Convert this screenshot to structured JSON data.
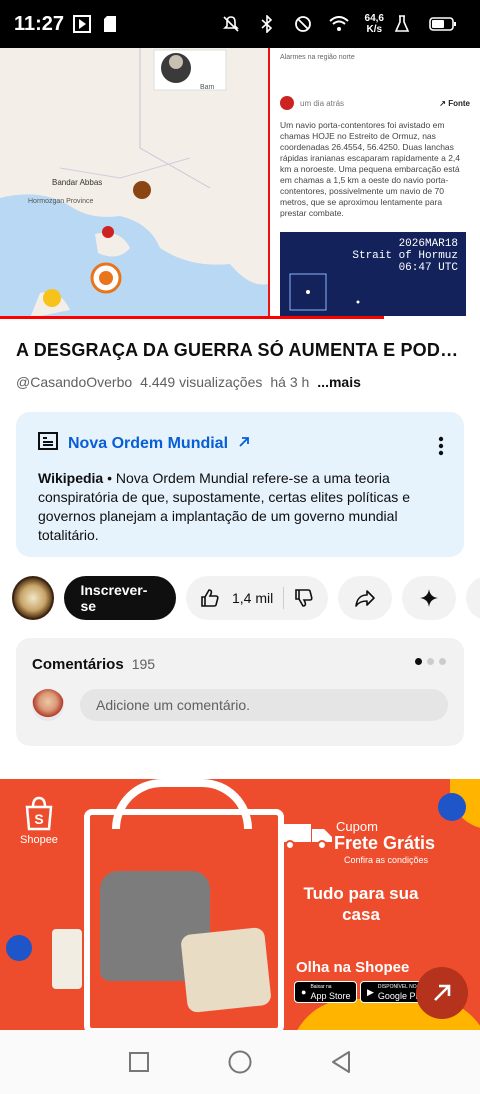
{
  "status_bar": {
    "time": "11:27",
    "speed_value": "64,6",
    "speed_unit": "K/s"
  },
  "video": {
    "overlay": {
      "top_news_label": "Alarmes na região norte",
      "source_time": "um dia atrás",
      "source_label": "Fonte",
      "news_text": "Um navio porta-contentores foi avistado em chamas HOJE no Estreito de Ormuz, nas coordenadas 26.4554, 56.4250. Duas lanchas rápidas iranianas escaparam rapidamente a 2,4 km a noroeste. Uma pequena embarcação está em chamas a 1,5 km a oeste do navio porta-contentores, possivelmente um navio de 70 metros, que se aproximou lentamente para prestar combate.",
      "image_caption_date": "2026MAR18",
      "image_caption_place": "Strait of Hormuz",
      "image_caption_time": "06:47 UTC",
      "map_labels": [
        "Bam",
        "Bandar Abbas",
        "Hormozgan Province"
      ]
    },
    "progress": 0.8
  },
  "title": "A DESGRAÇA DA GUERRA SÓ AUMENTA E PODE PIORAR",
  "meta": {
    "channel": "@CasandoOverbo",
    "views": "4.449 visualizações",
    "age": "há 3 h",
    "more": "...mais"
  },
  "wiki_card": {
    "heading": "Nova Ordem Mundial",
    "source": "Wikipedia",
    "text": " • Nova Ordem Mundial refere-se a uma teoria conspiratória de que, supostamente, certas elites políticas e governos planejam a implantação de um governo mundial totalitário."
  },
  "actions": {
    "subscribe": "Inscrever-se",
    "likes": "1,4 mil"
  },
  "comments": {
    "title": "Comentários",
    "count": "195",
    "placeholder": "Adicione um comentário."
  },
  "ad": {
    "brand": "Shopee",
    "cupom": "Cupom",
    "frete": "Frete Grátis",
    "condicoes": "Confira as condições",
    "tudo": "Tudo para sua casa",
    "olha": "Olha na Shopee",
    "app_store_small": "Baixar na",
    "app_store": "App Store",
    "google_play_small": "DISPONÍVEL NO",
    "google_play": "Google Play"
  },
  "colors": {
    "accent_red": "#ff0000",
    "link_blue": "#065fd4",
    "ad_orange": "#ee4d2d"
  },
  "icons": [
    "play-store-icon",
    "sd-card-icon",
    "mute-icon",
    "bluetooth-icon",
    "do-not-disturb-icon",
    "wifi-icon",
    "battery-icon",
    "wiki-doc-icon",
    "external-link-icon",
    "more-vert-icon",
    "like-icon",
    "dislike-icon",
    "share-icon",
    "sparkle-icon",
    "open-link-icon",
    "nav-recents-icon",
    "nav-home-icon",
    "nav-back-icon"
  ]
}
